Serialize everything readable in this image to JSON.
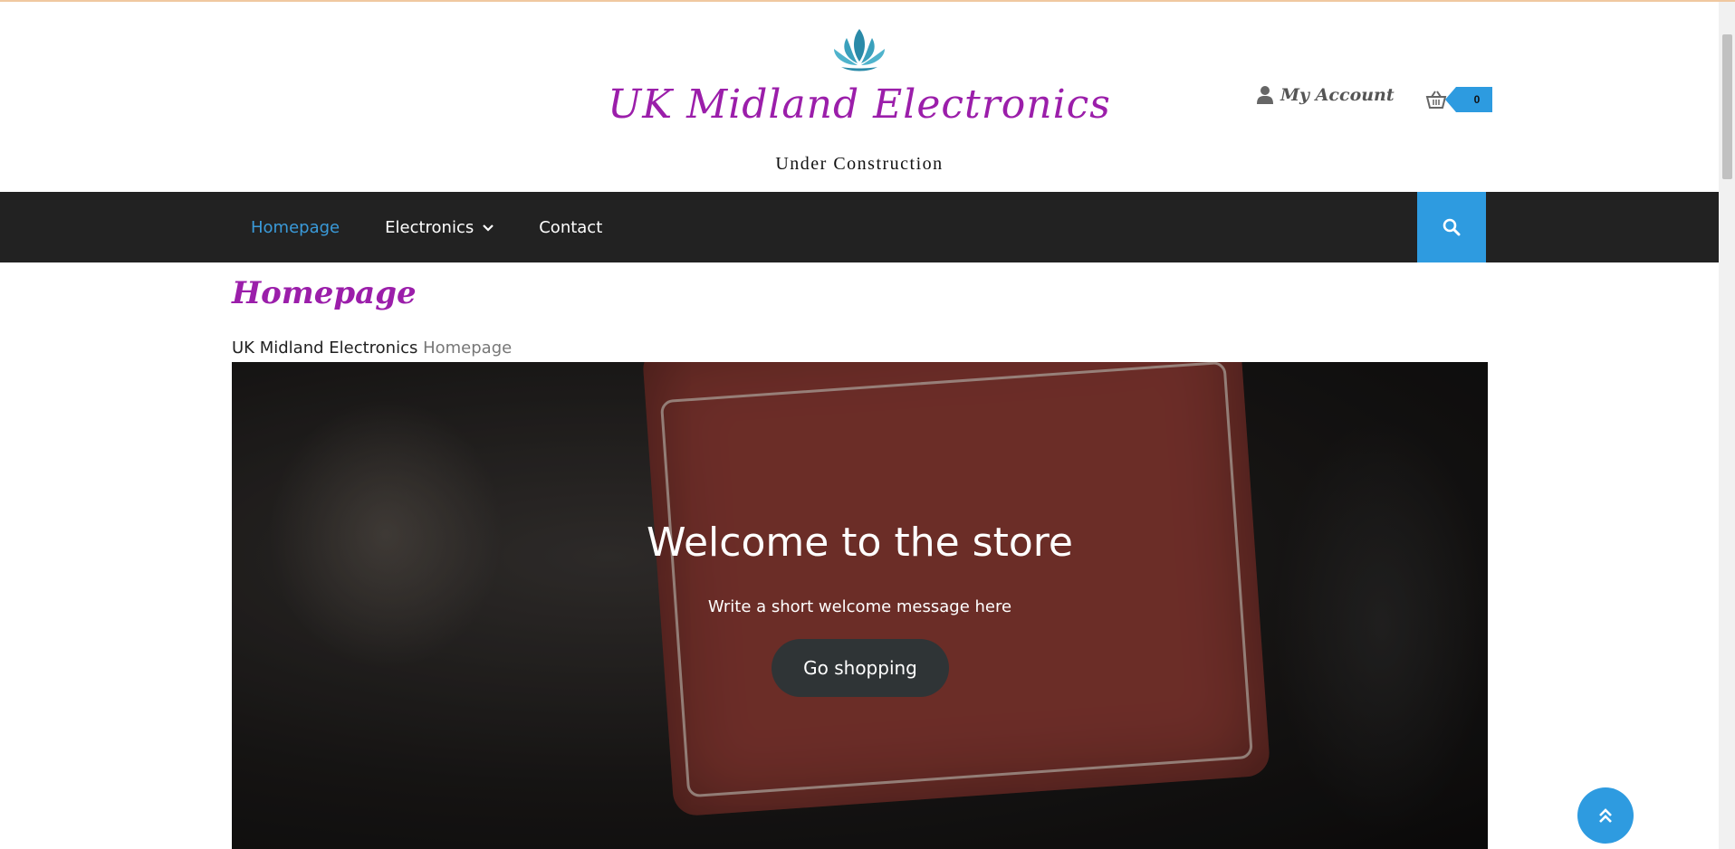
{
  "header": {
    "site_title": "UK Midland Electronics",
    "tagline": "Under Construction",
    "account_label": "My Account",
    "cart_count": "0",
    "logo_icon": "lotus-icon",
    "account_icon": "user-icon",
    "cart_icon": "basket-icon"
  },
  "nav": {
    "items": [
      {
        "label": "Homepage"
      },
      {
        "label": "Electronics"
      },
      {
        "label": "Contact"
      }
    ],
    "search_icon": "search-icon"
  },
  "page": {
    "heading": "Homepage",
    "breadcrumb_root": "UK Midland Electronics",
    "breadcrumb_current": "Homepage"
  },
  "hero": {
    "title": "Welcome to the store",
    "subtitle": "Write a short welcome message here",
    "button_label": "Go shopping"
  },
  "colors": {
    "brand_purple": "#9b1eaa",
    "accent_blue": "#2e9be0",
    "navbar_bg": "#222222"
  }
}
